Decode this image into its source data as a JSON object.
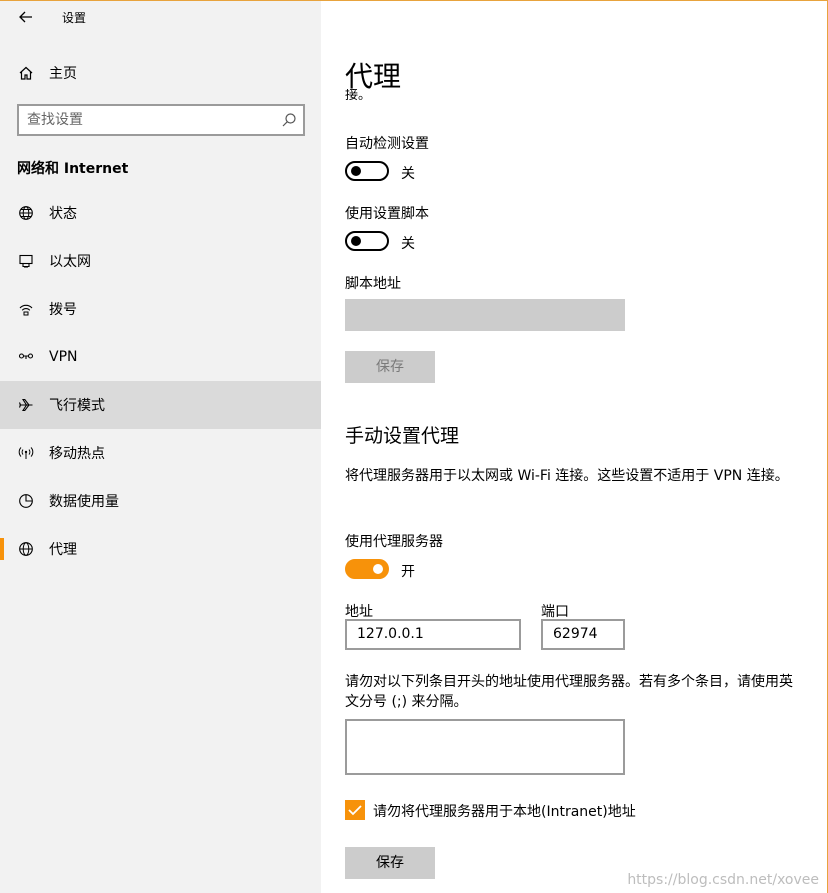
{
  "app": {
    "title": "设置",
    "back_icon": "arrow-left-icon"
  },
  "sidebar": {
    "home_label": "主页",
    "search": {
      "placeholder": "查找设置",
      "icon": "search-icon"
    },
    "section_heading": "网络和 Internet",
    "items": [
      {
        "label": "状态",
        "icon": "globe-status-icon"
      },
      {
        "label": "以太网",
        "icon": "ethernet-icon"
      },
      {
        "label": "拨号",
        "icon": "dialup-icon"
      },
      {
        "label": "VPN",
        "icon": "vpn-icon"
      },
      {
        "label": "飞行模式",
        "icon": "airplane-icon",
        "hover": true
      },
      {
        "label": "移动热点",
        "icon": "hotspot-icon"
      },
      {
        "label": "数据使用量",
        "icon": "data-usage-icon"
      },
      {
        "label": "代理",
        "icon": "globe-icon",
        "selected": true
      }
    ]
  },
  "main": {
    "title": "代理",
    "cut_text": "接。",
    "auto_detect": {
      "label": "自动检测设置",
      "state": "关",
      "on": false
    },
    "use_script": {
      "label": "使用设置脚本",
      "state": "关",
      "on": false
    },
    "script_address": {
      "label": "脚本地址",
      "value": ""
    },
    "save_disabled_label": "保存",
    "manual_heading": "手动设置代理",
    "manual_desc": "将代理服务器用于以太网或 Wi-Fi 连接。这些设置不适用于 VPN 连接。",
    "use_proxy": {
      "label": "使用代理服务器",
      "state": "开",
      "on": true
    },
    "address": {
      "label": "地址",
      "value": "127.0.0.1"
    },
    "port": {
      "label": "端口",
      "value": "62974"
    },
    "exceptions_desc": "请勿对以下列条目开头的地址使用代理服务器。若有多个条目，请使用英文分号 (;) 来分隔。",
    "exceptions_value": "",
    "local_checkbox": {
      "label": "请勿将代理服务器用于本地(Intranet)地址",
      "checked": true
    },
    "save_label": "保存"
  },
  "colors": {
    "accent": "#f7920a",
    "sidebar_bg": "#f2f2f2",
    "hover_bg": "#dadada",
    "disabled_bg": "#cccccc"
  },
  "watermark": "https://blog.csdn.net/xovee"
}
